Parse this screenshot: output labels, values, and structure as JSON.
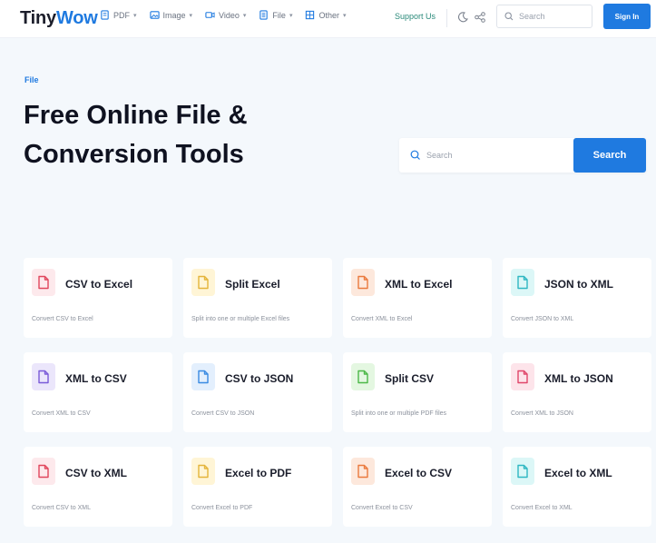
{
  "header": {
    "logo_tiny": "Tiny",
    "logo_wow": "Wow",
    "nav": [
      {
        "label": "PDF",
        "icon": "pdf-icon",
        "color": "#1f7ae0"
      },
      {
        "label": "Image",
        "icon": "image-icon",
        "color": "#1f7ae0"
      },
      {
        "label": "Video",
        "icon": "video-icon",
        "color": "#1f7ae0"
      },
      {
        "label": "File",
        "icon": "file-icon",
        "color": "#1f7ae0"
      },
      {
        "label": "Other",
        "icon": "other-icon",
        "color": "#1f7ae0"
      }
    ],
    "support_label": "Support Us",
    "search_placeholder": "Search",
    "signin_label": "Sign In"
  },
  "hero": {
    "breadcrumb": "File",
    "title_line1": "Free Online File &",
    "title_line2": "Conversion Tools",
    "search_placeholder": "Search",
    "search_button": "Search"
  },
  "colors": {
    "accent": "#1f7ae0",
    "background": "#f4f8fc"
  },
  "tools": [
    {
      "title": "CSV to Excel",
      "desc": "Convert CSV to Excel",
      "tile_bg": "#fde9ec",
      "icon_color": "#e0465c"
    },
    {
      "title": "Split Excel",
      "desc": "Split into one or multiple Excel files",
      "tile_bg": "#fff5d6",
      "icon_color": "#e4b43a"
    },
    {
      "title": "XML to Excel",
      "desc": "Convert XML to Excel",
      "tile_bg": "#fde8dc",
      "icon_color": "#ea7a3e"
    },
    {
      "title": "JSON to XML",
      "desc": "Convert JSON to XML",
      "tile_bg": "#dcf7f7",
      "icon_color": "#2fb7c2"
    },
    {
      "title": "XML to CSV",
      "desc": "Convert XML to CSV",
      "tile_bg": "#ebe6fb",
      "icon_color": "#7a5ad8"
    },
    {
      "title": "CSV to JSON",
      "desc": "Convert CSV to JSON",
      "tile_bg": "#e3effd",
      "icon_color": "#3a8be2"
    },
    {
      "title": "Split CSV",
      "desc": "Split into one or multiple PDF files",
      "tile_bg": "#e4f7e1",
      "icon_color": "#4cb848"
    },
    {
      "title": "XML to JSON",
      "desc": "Convert XML to JSON",
      "tile_bg": "#fde4ea",
      "icon_color": "#e0466a"
    },
    {
      "title": "CSV to XML",
      "desc": "Convert CSV to XML",
      "tile_bg": "#fde9ec",
      "icon_color": "#e0465c"
    },
    {
      "title": "Excel to PDF",
      "desc": "Convert Excel to PDF",
      "tile_bg": "#fff5d6",
      "icon_color": "#e4b43a"
    },
    {
      "title": "Excel to CSV",
      "desc": "Convert Excel to CSV",
      "tile_bg": "#fde8dc",
      "icon_color": "#ea7a3e"
    },
    {
      "title": "Excel to XML",
      "desc": "Convert Excel to XML",
      "tile_bg": "#dcf7f7",
      "icon_color": "#2fb7c2"
    }
  ]
}
